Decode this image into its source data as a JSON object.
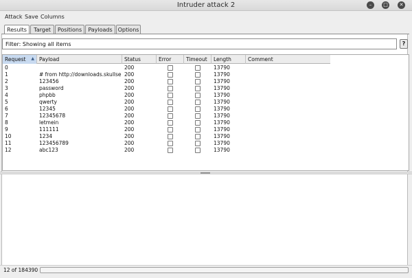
{
  "window": {
    "title": "Intruder attack 2"
  },
  "menu": [
    "Attack",
    "Save",
    "Columns"
  ],
  "tabs": [
    {
      "label": "Results",
      "active": true
    },
    {
      "label": "Target",
      "active": false
    },
    {
      "label": "Positions",
      "active": false
    },
    {
      "label": "Payloads",
      "active": false
    },
    {
      "label": "Options",
      "active": false
    }
  ],
  "filter": {
    "text": "Filter: Showing all items",
    "help_label": "?"
  },
  "table": {
    "columns": [
      "Request",
      "Payload",
      "Status",
      "Error",
      "Timeout",
      "Length",
      "Comment"
    ],
    "sort_column": "Request",
    "rows": [
      {
        "request": "0",
        "payload": "",
        "status": "200",
        "length": "13790"
      },
      {
        "request": "1",
        "payload": "# from http://downloads.skullse...",
        "status": "200",
        "length": "13790"
      },
      {
        "request": "2",
        "payload": "123456",
        "status": "200",
        "length": "13790"
      },
      {
        "request": "3",
        "payload": "password",
        "status": "200",
        "length": "13790"
      },
      {
        "request": "4",
        "payload": "phpbb",
        "status": "200",
        "length": "13790"
      },
      {
        "request": "5",
        "payload": "qwerty",
        "status": "200",
        "length": "13790"
      },
      {
        "request": "6",
        "payload": "12345",
        "status": "200",
        "length": "13790"
      },
      {
        "request": "7",
        "payload": "12345678",
        "status": "200",
        "length": "13790"
      },
      {
        "request": "8",
        "payload": "letmein",
        "status": "200",
        "length": "13790"
      },
      {
        "request": "9",
        "payload": "111111",
        "status": "200",
        "length": "13790"
      },
      {
        "request": "10",
        "payload": "1234",
        "status": "200",
        "length": "13790"
      },
      {
        "request": "11",
        "payload": "123456789",
        "status": "200",
        "length": "13790"
      },
      {
        "request": "12",
        "payload": "abc123",
        "status": "200",
        "length": "13790"
      }
    ]
  },
  "status": {
    "text": "12 of 184390",
    "progress": 0.0
  },
  "colors": {
    "accent": "#c8daf0",
    "progress": "#6d8fbf"
  }
}
